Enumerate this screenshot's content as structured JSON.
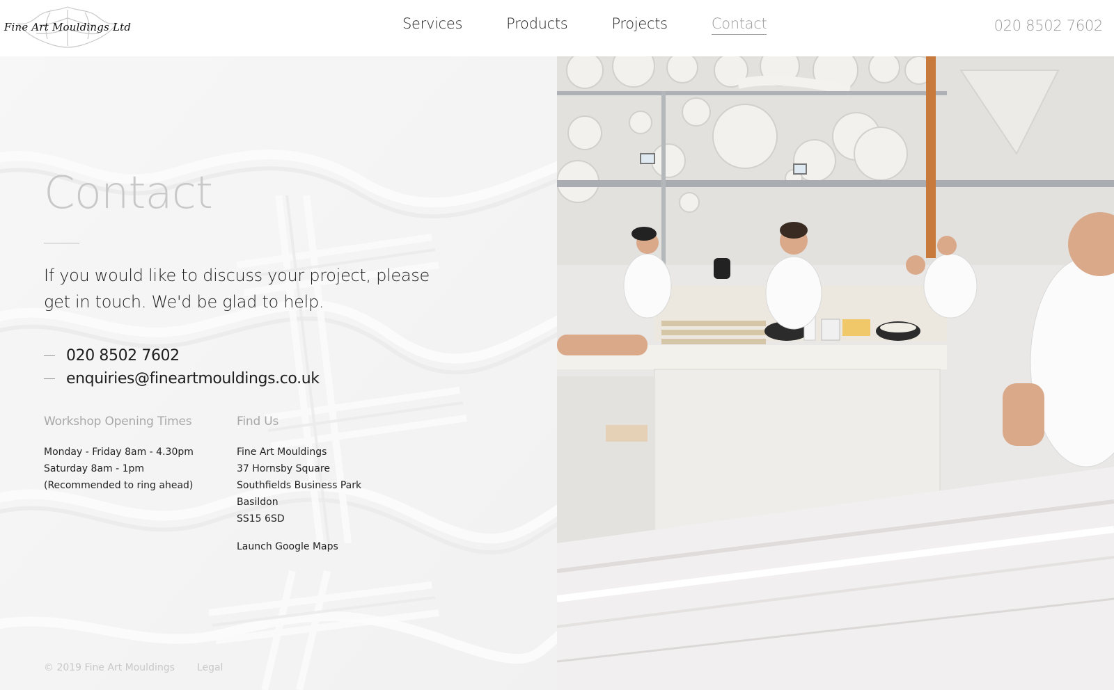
{
  "header": {
    "logo_text": "Fine Art Mouldings Ltd",
    "nav": [
      {
        "label": "Services",
        "active": false
      },
      {
        "label": "Products",
        "active": false
      },
      {
        "label": "Projects",
        "active": false
      },
      {
        "label": "Contact",
        "active": true
      }
    ],
    "phone": "020 8502 7602"
  },
  "main": {
    "title": "Contact",
    "intro": "If you would like to discuss your project, please get in touch. We'd be glad to help.",
    "contacts": {
      "phone": "020 8502 7602",
      "email": "enquiries@fineartmouldings.co.uk"
    },
    "opening_times": {
      "heading": "Workshop Opening Times",
      "lines": [
        "Monday - Friday 8am - 4.30pm",
        "Saturday 8am - 1pm",
        "(Recommended to ring ahead)"
      ]
    },
    "find_us": {
      "heading": "Find Us",
      "lines": [
        "Fine Art Mouldings",
        "37 Hornsby Square",
        "Southfields Business Park",
        "Basildon",
        "SS15 6SD"
      ],
      "maps_link": "Launch Google Maps"
    }
  },
  "footer": {
    "copyright": "© 2019 Fine Art Mouldings",
    "legal": "Legal"
  },
  "colors": {
    "accent_grey": "#9a9a9a",
    "text_dark": "#1e1e1e",
    "left_background": "#f4f4f4"
  },
  "photo": {
    "description_icon": "workshop-photo"
  }
}
